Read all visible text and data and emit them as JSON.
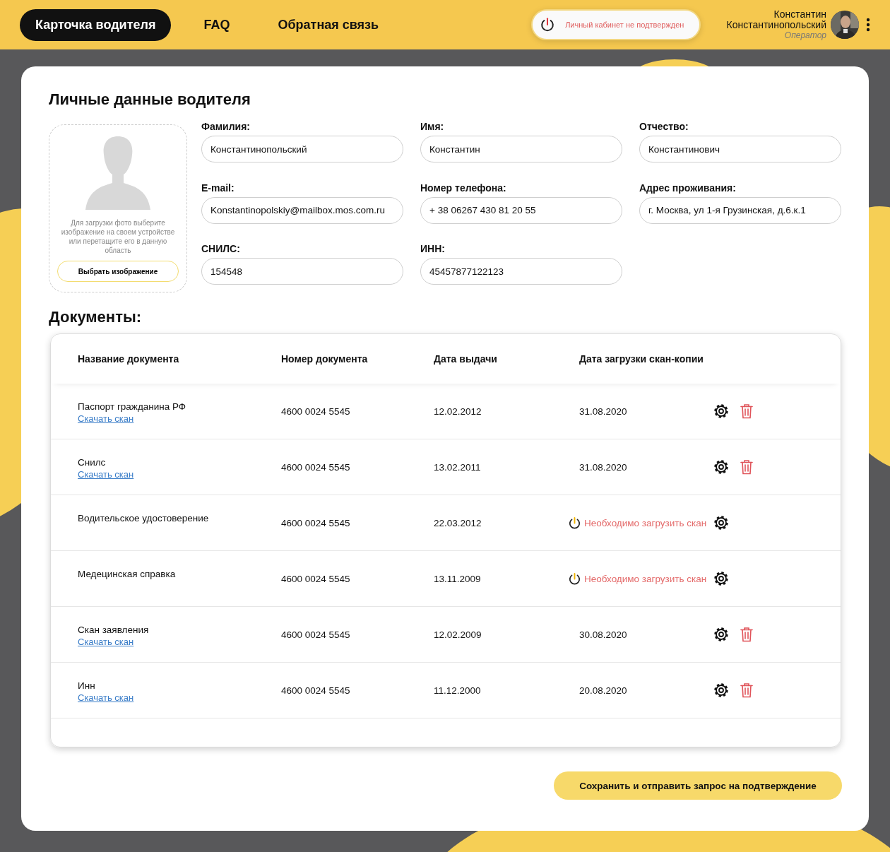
{
  "header": {
    "nav_items": [
      {
        "label": "Карточка водителя",
        "selected": true
      },
      {
        "label": "FAQ",
        "selected": false
      },
      {
        "label": "Обратная связь",
        "selected": false
      }
    ],
    "status_badge": {
      "text": "Личный кабинет не подтвержден"
    },
    "user": {
      "first_name": "Константин",
      "last_name": "Константинопольский",
      "role": "Оператор"
    }
  },
  "personal": {
    "title": "Личные данные водителя",
    "photo_upload": {
      "hint": "Для загрузки фото выберите изображение на своем устройстве или перетащите его в данную область",
      "button": "Выбрать изображение"
    },
    "fields": [
      {
        "label": "Фамилия:",
        "value": "Константинопольский"
      },
      {
        "label": "Имя:",
        "value": "Константин"
      },
      {
        "label": "Отчество:",
        "value": "Константинович"
      },
      {
        "label": "E-mail:",
        "value": "Konstantinopolskiy@mailbox.mos.com.ru"
      },
      {
        "label": "Номер телефона:",
        "value": "+ 38 06267 430 81 20 55"
      },
      {
        "label": "Адрес проживания:",
        "value": "г. Москва, ул 1-я Грузинская, д.6.к.1"
      },
      {
        "label": "СНИЛС:",
        "value": "154548"
      },
      {
        "label": "ИНН:",
        "value": "45457877122123"
      }
    ]
  },
  "documents": {
    "title": "Документы:",
    "columns": [
      "Название документа",
      "Номер документа",
      "Дата выдачи",
      "Дата загрузки скан-копии"
    ],
    "rows": [
      {
        "name": "Паспорт гражданина РФ",
        "link": "Скачать скан",
        "number": "4600 0024 5545",
        "issue_date": "12.02.2012",
        "upload": {
          "kind": "date",
          "text": "31.08.2020"
        },
        "deletable": true
      },
      {
        "name": "Снилс",
        "link": "Скачать скан",
        "number": "4600 0024 5545",
        "issue_date": "13.02.2011",
        "upload": {
          "kind": "date",
          "text": "31.08.2020"
        },
        "deletable": true
      },
      {
        "name": "Водительское удостоверение",
        "number": "4600 0024 5545",
        "issue_date": "22.03.2012",
        "upload": {
          "kind": "missing",
          "text": "Необходимо загрузить скан"
        },
        "deletable": false
      },
      {
        "name": "Медецинская справка",
        "number": "4600 0024 5545",
        "issue_date": "13.11.2009",
        "upload": {
          "kind": "missing",
          "text": "Необходимо загрузить скан"
        },
        "deletable": false
      },
      {
        "name": "Скан заявления",
        "link": "Скачать скан",
        "number": "4600 0024 5545",
        "issue_date": "12.02.2009",
        "upload": {
          "kind": "date",
          "text": "30.08.2020"
        },
        "deletable": true
      },
      {
        "name": "Инн",
        "link": "Скачать скан",
        "number": "4600 0024 5545",
        "issue_date": "11.12.2000",
        "upload": {
          "kind": "date",
          "text": "20.08.2020"
        },
        "deletable": true
      }
    ]
  },
  "save_button": "Сохранить и отправить запрос на подтверждение"
}
